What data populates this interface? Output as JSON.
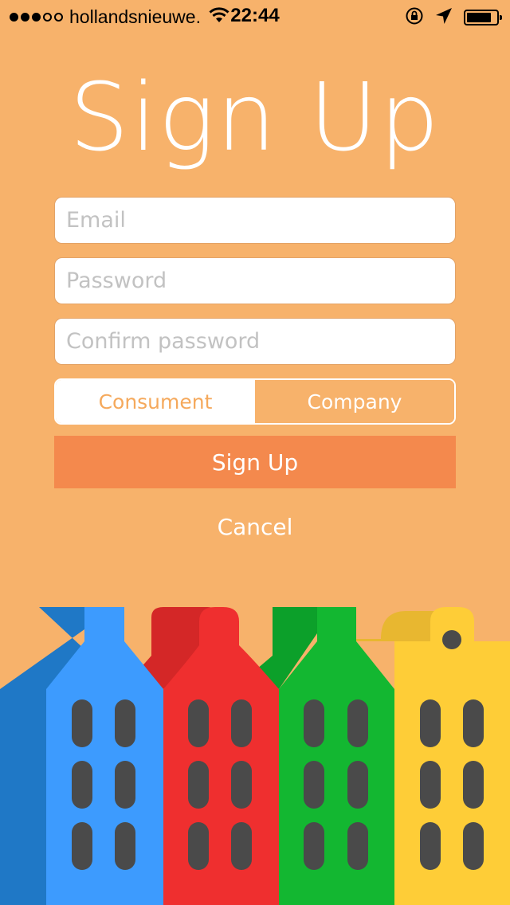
{
  "status_bar": {
    "carrier": "hollandsnieuwe.",
    "time": "22:44",
    "signal_bars_filled": 3,
    "signal_bars_total": 5,
    "battery_level": 0.85
  },
  "title": "Sign Up",
  "form": {
    "email_placeholder": "Email",
    "password_placeholder": "Password",
    "confirm_placeholder": "Confirm password",
    "email_value": "",
    "password_value": "",
    "confirm_value": ""
  },
  "account_type": {
    "options": [
      "Consument",
      "Company"
    ],
    "selected": "Consument"
  },
  "signup_button_label": "Sign Up",
  "cancel_label": "Cancel",
  "colors": {
    "background": "#f7b26b",
    "accent_button": "#f4894d",
    "building_blue": "#3d9bfe",
    "building_red": "#ef2f2f",
    "building_green": "#13b731",
    "building_yellow": "#fecd37",
    "window": "#4a4a4a"
  },
  "icons": [
    "wifi-icon",
    "rotation-lock-icon",
    "location-arrow-icon",
    "battery-icon"
  ]
}
